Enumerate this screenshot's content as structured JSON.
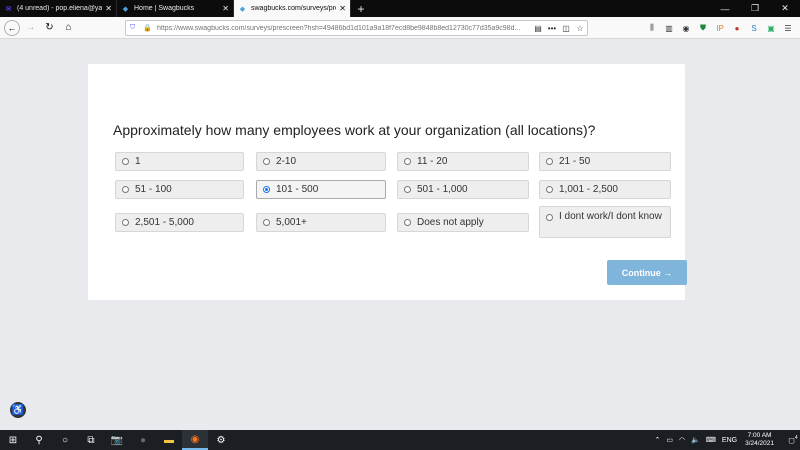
{
  "browser": {
    "tabs": [
      {
        "title": "(4 unread) - pop.eliena@yahoo...",
        "icon": "yahoo-mail-icon"
      },
      {
        "title": "Home | Swagbucks",
        "icon": "swagbucks-icon"
      },
      {
        "title": "swagbucks.com/surveys/prescr...",
        "icon": "swagbucks-icon"
      }
    ],
    "new_tab": "+",
    "url": "https://www.swagbucks.com/surveys/prescreen?hsh=49486bd1d101a9a18f7ecd8be9848b8ed12730c77d35a9c98d..."
  },
  "survey": {
    "question": "Approximately how many employees work at your organization (all locations)?",
    "options": [
      {
        "label": "1"
      },
      {
        "label": "2-10"
      },
      {
        "label": "11 - 20"
      },
      {
        "label": "21 - 50"
      },
      {
        "label": "51 - 100"
      },
      {
        "label": "101 - 500"
      },
      {
        "label": "501 - 1,000"
      },
      {
        "label": "1,001 - 2,500"
      },
      {
        "label": "2,501 - 5,000"
      },
      {
        "label": "5,001+"
      },
      {
        "label": "Does not apply"
      },
      {
        "label": "I dont work/I dont know"
      }
    ],
    "selected": "101 - 500",
    "continue_label": "Continue →"
  },
  "taskbar": {
    "language": "ENG",
    "time": "7:00 AM",
    "date": "3/24/2021",
    "notification_count": "4"
  },
  "colors": {
    "continue_button": "#7fb5db",
    "selected_radio": "#1a73e8",
    "taskbar": "#1b1f24"
  }
}
